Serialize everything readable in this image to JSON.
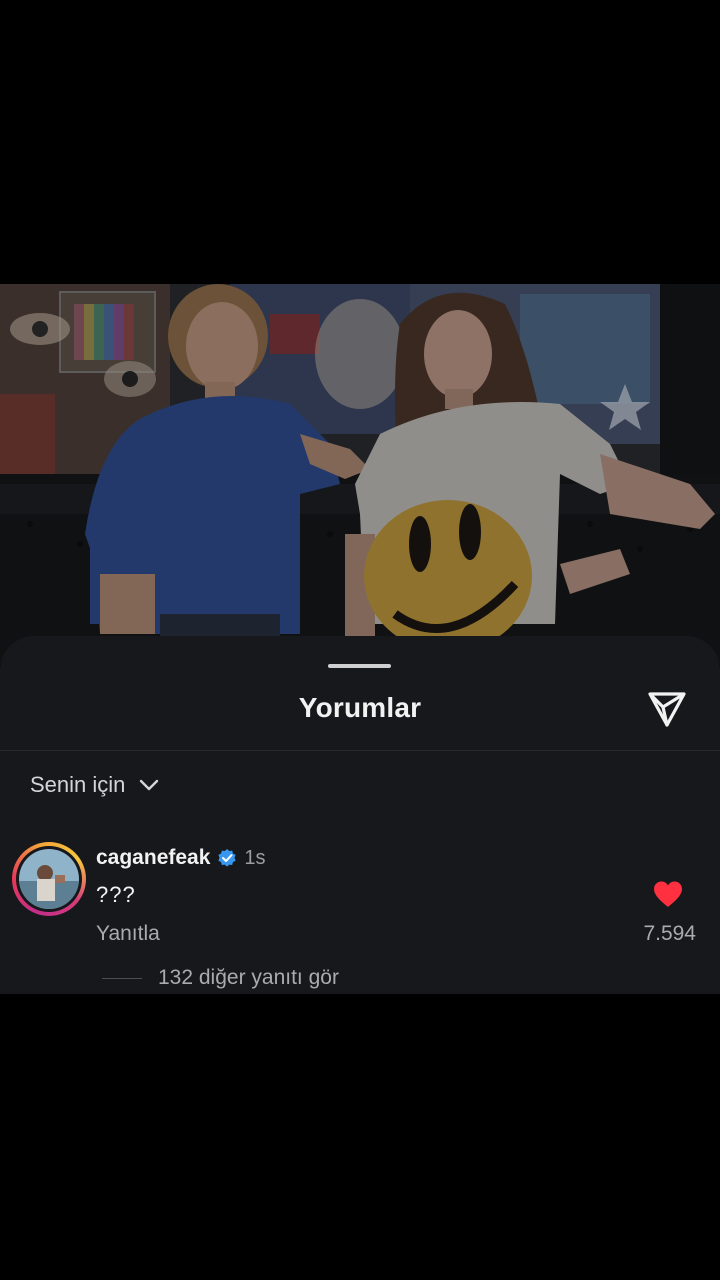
{
  "sheet": {
    "title": "Yorumlar",
    "share_icon": "send-icon"
  },
  "filter": {
    "label": "Senin için",
    "icon": "chevron-down-icon"
  },
  "comment": {
    "username": "caganefeak",
    "verified": true,
    "time": "1s",
    "text": "???",
    "reply_label": "Yanıtla",
    "liked": true,
    "like_count": "7.594",
    "more_replies_label": "132 diğer yanıtı gör"
  },
  "colors": {
    "sheet_bg": "#16181b",
    "verified_blue": "#3797f0",
    "like_red": "#ff3040"
  }
}
